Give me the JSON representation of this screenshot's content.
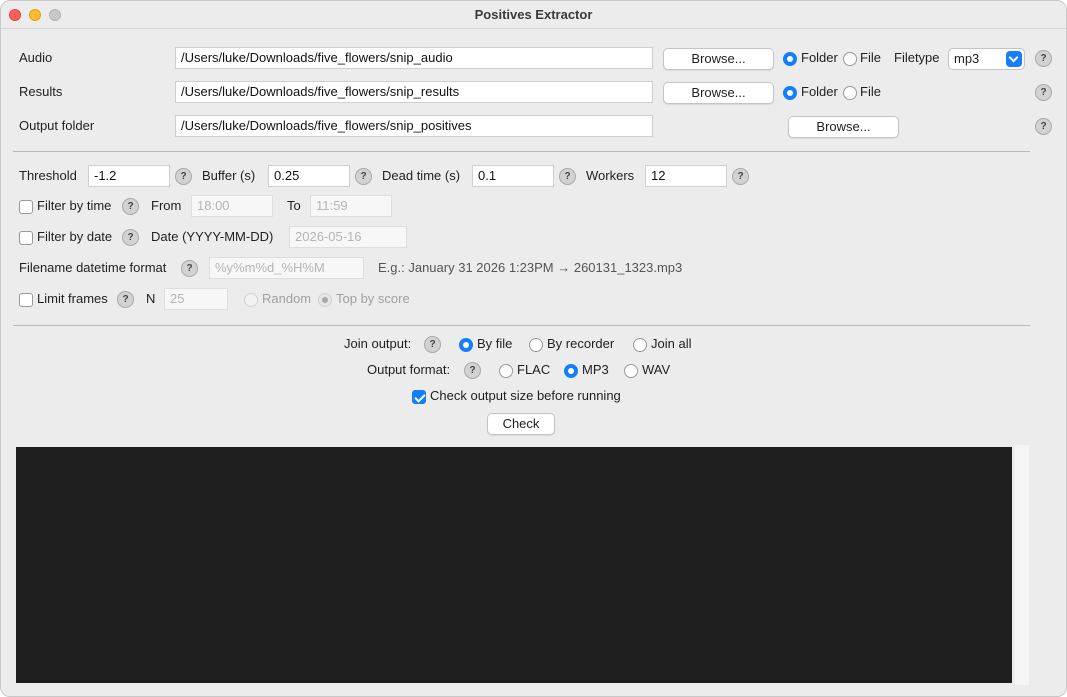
{
  "window": {
    "title": "Positives Extractor"
  },
  "audio": {
    "label": "Audio",
    "path": "/Users/luke/Downloads/five_flowers/snip_audio",
    "browse": "Browse...",
    "folder": "Folder",
    "file": "File",
    "filetype_label": "Filetype",
    "filetype": "mp3",
    "selected": "Folder"
  },
  "results": {
    "label": "Results",
    "path": "/Users/luke/Downloads/five_flowers/snip_results",
    "browse": "Browse...",
    "folder": "Folder",
    "file": "File",
    "selected": "Folder"
  },
  "output": {
    "label": "Output folder",
    "path": "/Users/luke/Downloads/five_flowers/snip_positives",
    "browse": "Browse..."
  },
  "params": {
    "threshold_label": "Threshold",
    "threshold": "-1.2",
    "buffer_label": "Buffer (s)",
    "buffer": "0.25",
    "dead_label": "Dead time (s)",
    "dead": "0.1",
    "workers_label": "Workers",
    "workers": "12"
  },
  "filter_time": {
    "label": "Filter by time",
    "checked": false,
    "from_label": "From",
    "from": "18:00",
    "to_label": "To",
    "to": "11:59"
  },
  "filter_date": {
    "label": "Filter by date",
    "checked": false,
    "date_label": "Date (YYYY-MM-DD)",
    "date": "2026-05-16"
  },
  "datetime_format": {
    "label": "Filename datetime format",
    "value": "%y%m%d_%H%M",
    "example": "E.g.: January 31 2026 1:23PM → 260131_1323.mp3"
  },
  "limit": {
    "label": "Limit frames",
    "checked": false,
    "n_label": "N",
    "n": "25",
    "random": "Random",
    "top": "Top by score",
    "selected": "Top by score"
  },
  "join": {
    "label": "Join output:",
    "options": [
      "By file",
      "By recorder",
      "Join all"
    ],
    "selected": "By file"
  },
  "format": {
    "label": "Output format:",
    "options": [
      "FLAC",
      "MP3",
      "WAV"
    ],
    "selected": "MP3"
  },
  "check_size": {
    "label": "Check output size before running",
    "checked": true
  },
  "check_button": "Check",
  "help_glyph": "?",
  "colors": {
    "accent": "#147efb",
    "console_bg": "#1e1e1e",
    "window_bg": "#ececec"
  }
}
